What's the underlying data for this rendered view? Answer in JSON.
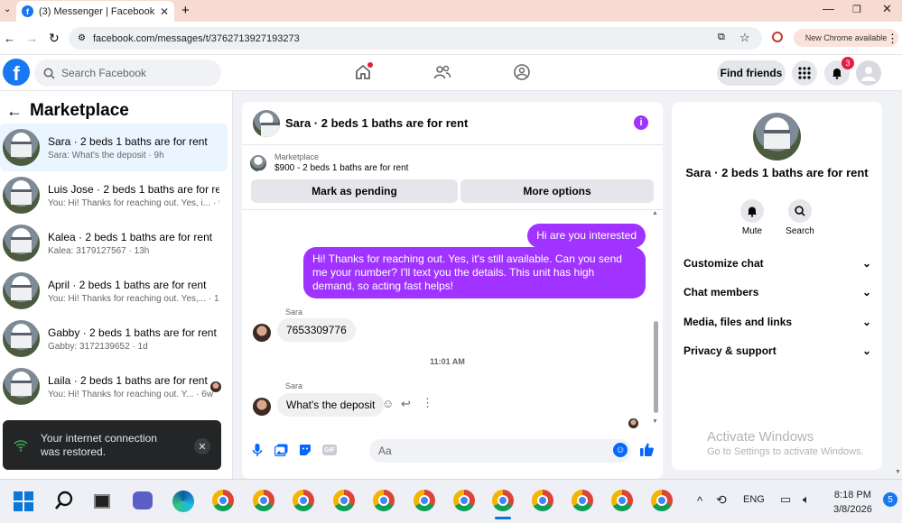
{
  "browser": {
    "tab_title": "(3) Messenger | Facebook",
    "url": "facebook.com/messages/t/37627139271932​73",
    "chrome_chip": "New Chrome available"
  },
  "header": {
    "search_placeholder": "Search Facebook",
    "find_friends": "Find friends",
    "notification_count": "3"
  },
  "sidebar": {
    "title": "Marketplace",
    "conversations": [
      {
        "title": "Sara · 2 beds 1 baths are for rent",
        "preview": "Sara: What's the deposit · 9h"
      },
      {
        "title": "Luis Jose · 2 beds 1 baths are for re...",
        "preview": "You: Hi! Thanks for reaching out. Yes, i... · 9h"
      },
      {
        "title": "Kalea · 2 beds 1 baths are for rent",
        "preview": "Kalea: 3179127567 · 13h"
      },
      {
        "title": "April · 2 beds 1 baths are for rent",
        "preview": "You: Hi! Thanks for reaching out. Yes,... · 13h"
      },
      {
        "title": "Gabby · 2 beds 1 baths are for rent",
        "preview": "Gabby: 3172139652 · 1d"
      },
      {
        "title": "Laila · 2 beds 1 baths are for rent",
        "preview": "You: Hi! Thanks for reaching out. Y... · 6w"
      }
    ],
    "toast": "Your internet connection was restored."
  },
  "chat": {
    "title": "Sara · 2 beds 1 baths are for rent",
    "marketplace_label": "Marketplace",
    "listing": "$900 - 2 beds 1 baths are for rent",
    "mark_pending": "Mark as pending",
    "more_options": "More options",
    "messages": {
      "out1": "Hi are you interested",
      "out2": "Hi! Thanks for reaching out. Yes, it's still available. Can you send me your number? I'll text you the details. This unit has high demand, so acting fast helps!",
      "sender1": "Sara",
      "in1": "7653309776",
      "timestamp": "11:01 AM",
      "sender2": "Sara",
      "in2": "What's the deposit"
    },
    "composer_placeholder": "Aa"
  },
  "details": {
    "title": "Sara · 2 beds 1 baths are for rent",
    "mute": "Mute",
    "search": "Search",
    "sections": [
      "Customize chat",
      "Chat members",
      "Media, files and links",
      "Privacy & support"
    ]
  },
  "watermark": {
    "line1": "Activate Windows",
    "line2": "Go to Settings to activate Windows."
  },
  "taskbar": {
    "lang": "ENG",
    "time": "8:18 PM",
    "date": "3/8/2026",
    "notification_count": "5"
  }
}
